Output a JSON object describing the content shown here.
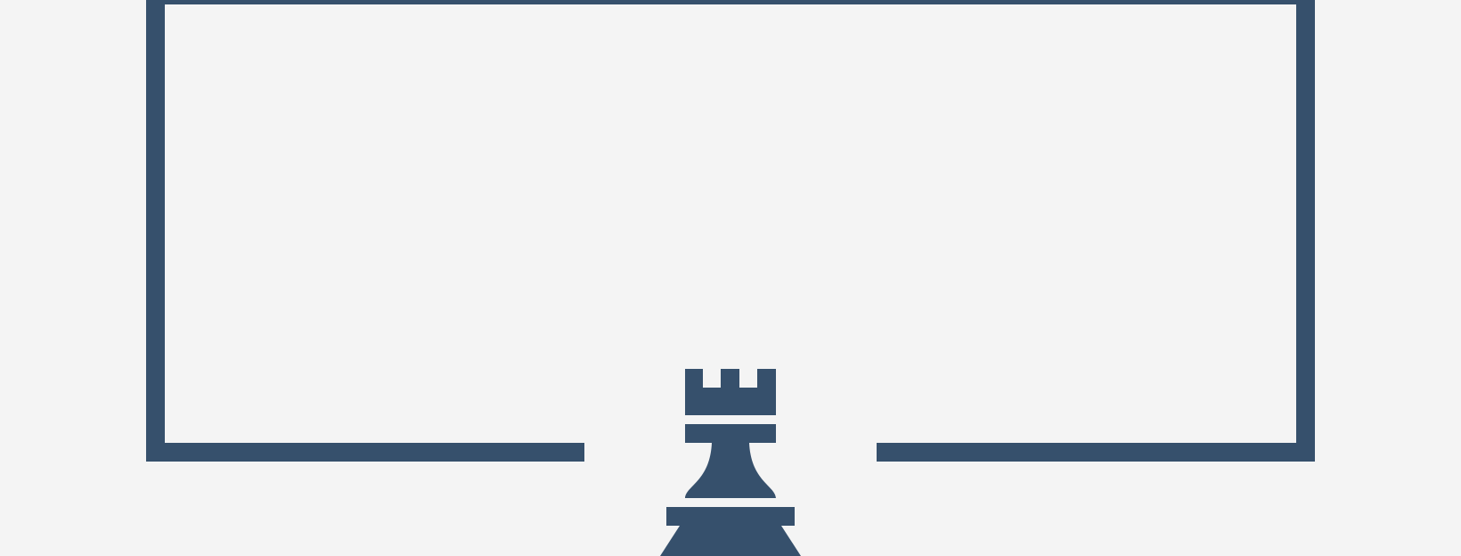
{
  "colors": {
    "background": "#f4f4f4",
    "accent": "#36506c"
  },
  "graphic": {
    "frame_icon": "open-bracket-frame",
    "piece_icon": "chess-rook-icon"
  }
}
